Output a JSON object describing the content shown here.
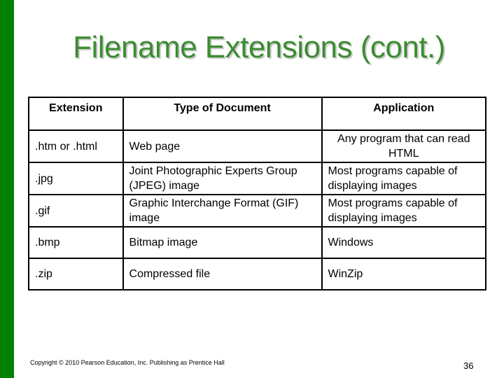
{
  "slide": {
    "title": "Filename Extensions (cont.)",
    "accent_color": "#008000",
    "title_color": "#3c8c32"
  },
  "table": {
    "headers": [
      "Extension",
      "Type of Document",
      "Application"
    ],
    "rows": [
      {
        "extension": ".htm or .html",
        "type": "Web page",
        "application": "Any program that can read HTML"
      },
      {
        "extension": ".jpg",
        "type": "Joint Photographic Experts Group (JPEG) image",
        "application": "Most programs capable of displaying images"
      },
      {
        "extension": ".gif",
        "type": "Graphic Interchange Format (GIF) image",
        "application": "Most programs capable of displaying images"
      },
      {
        "extension": ".bmp",
        "type": "Bitmap image",
        "application": "Windows"
      },
      {
        "extension": ".zip",
        "type": "Compressed file",
        "application": "WinZip"
      }
    ]
  },
  "footer": {
    "copyright": "Copyright © 2010 Pearson Education, Inc. Publishing as Prentice Hall",
    "page_number": "36"
  }
}
